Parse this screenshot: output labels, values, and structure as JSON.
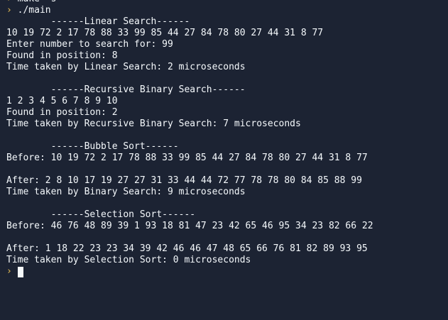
{
  "terminal": {
    "prompt_glyph": "›",
    "lines": [
      {
        "kind": "cmd",
        "text": "make -s"
      },
      {
        "kind": "cmd",
        "text": "./main"
      },
      {
        "kind": "out",
        "text": "        ------Linear Search------"
      },
      {
        "kind": "out",
        "text": "10 19 72 2 17 78 88 33 99 85 44 27 84 78 80 27 44 31 8 77"
      },
      {
        "kind": "out",
        "text": "Enter number to search for: 99"
      },
      {
        "kind": "out",
        "text": "Found in position: 8"
      },
      {
        "kind": "out",
        "text": "Time taken by Linear Search: 2 microseconds"
      },
      {
        "kind": "out",
        "text": ""
      },
      {
        "kind": "out",
        "text": "        ------Recursive Binary Search------"
      },
      {
        "kind": "out",
        "text": "1 2 3 4 5 6 7 8 9 10"
      },
      {
        "kind": "out",
        "text": "Found in position: 2"
      },
      {
        "kind": "out",
        "text": "Time taken by Recursive Binary Search: 7 microseconds"
      },
      {
        "kind": "out",
        "text": ""
      },
      {
        "kind": "out",
        "text": "        ------Bubble Sort------"
      },
      {
        "kind": "out",
        "text": "Before: 10 19 72 2 17 78 88 33 99 85 44 27 84 78 80 27 44 31 8 77"
      },
      {
        "kind": "out",
        "text": ""
      },
      {
        "kind": "out",
        "text": "After: 2 8 10 17 19 27 27 31 33 44 44 72 77 78 78 80 84 85 88 99"
      },
      {
        "kind": "out",
        "text": "Time taken by Binary Search: 9 microseconds"
      },
      {
        "kind": "out",
        "text": ""
      },
      {
        "kind": "out",
        "text": "        ------Selection Sort------"
      },
      {
        "kind": "out",
        "text": "Before: 46 76 48 89 39 1 93 18 81 47 23 42 65 46 95 34 23 82 66 22"
      },
      {
        "kind": "out",
        "text": ""
      },
      {
        "kind": "out",
        "text": "After: 1 18 22 23 23 34 39 42 46 46 47 48 65 66 76 81 82 89 93 95"
      },
      {
        "kind": "out",
        "text": "Time taken by Selection Sort: 0 microseconds"
      },
      {
        "kind": "input",
        "text": ""
      }
    ]
  },
  "colors": {
    "background": "#1c2333",
    "foreground": "#f5f9fc",
    "prompt": "#f0c455",
    "cursor": "#f5f9fc"
  }
}
